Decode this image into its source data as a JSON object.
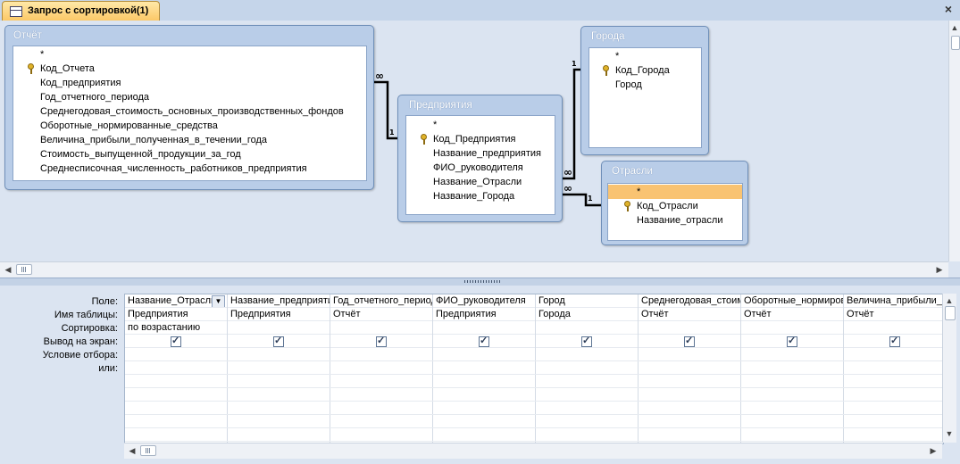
{
  "window": {
    "tab_title": "Запрос с сортировкой(1)",
    "close_glyph": "×"
  },
  "tables": {
    "otchet": {
      "title": "Отчёт",
      "fields": [
        "*",
        "Код_Отчета",
        "Код_предприятия",
        "Год_отчетного_периода",
        "Среднегодовая_стоимость_основных_производственных_фондов",
        "Оборотные_нормированные_средства",
        "Величина_прибыли_полученная_в_течении_года",
        "Стоимость_выпущенной_продукции_за_год",
        "Среднесписочная_численность_работников_предприятия"
      ]
    },
    "predpriyatiya": {
      "title": "Предприятия",
      "fields": [
        "*",
        "Код_Предприятия",
        "Название_предприятия",
        "ФИО_руководителя",
        "Название_Отрасли",
        "Название_Города"
      ]
    },
    "goroda": {
      "title": "Города",
      "fields": [
        "*",
        "Код_Города",
        "Город"
      ]
    },
    "otrasli": {
      "title": "Отрасли",
      "fields": [
        "*",
        "Код_Отрасли",
        "Название_отрасли"
      ]
    }
  },
  "relations": {
    "one": "1",
    "many": "∞"
  },
  "grid": {
    "row_labels": [
      "Поле:",
      "Имя таблицы:",
      "Сортировка:",
      "Вывод на экран:",
      "Условие отбора:",
      "или:"
    ],
    "columns": [
      {
        "field": "Название_Отрасли",
        "table": "Предприятия",
        "sort": "по возрастанию",
        "show": true
      },
      {
        "field": "Название_предприятия",
        "table": "Предприятия",
        "sort": "",
        "show": true
      },
      {
        "field": "Год_отчетного_периода",
        "table": "Отчёт",
        "sort": "",
        "show": true
      },
      {
        "field": "ФИО_руководителя",
        "table": "Предприятия",
        "sort": "",
        "show": true
      },
      {
        "field": "Город",
        "table": "Города",
        "sort": "",
        "show": true
      },
      {
        "field": "Среднегодовая_стоимость_основных_производственных_фондов",
        "table": "Отчёт",
        "sort": "",
        "show": true
      },
      {
        "field": "Оборотные_нормированные_средства",
        "table": "Отчёт",
        "sort": "",
        "show": true
      },
      {
        "field": "Величина_прибыли_полученная_в_течении_года",
        "table": "Отчёт",
        "sort": "",
        "show": true
      }
    ]
  }
}
